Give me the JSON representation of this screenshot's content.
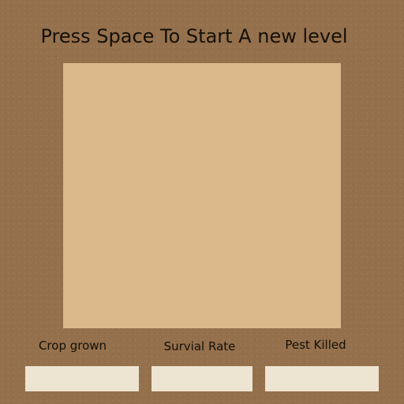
{
  "status": {
    "message": "Press Space To Start A new level"
  },
  "stats": {
    "crop_grown": {
      "label": "Crop grown",
      "value": ""
    },
    "survival_rate": {
      "label": "Survial Rate",
      "value": ""
    },
    "pest_killed": {
      "label": "Pest Killed",
      "value": ""
    }
  },
  "colors": {
    "background": "#95704c",
    "play_area": "#dbb98b",
    "stat_box": "#ede4d2",
    "text": "#141008"
  }
}
